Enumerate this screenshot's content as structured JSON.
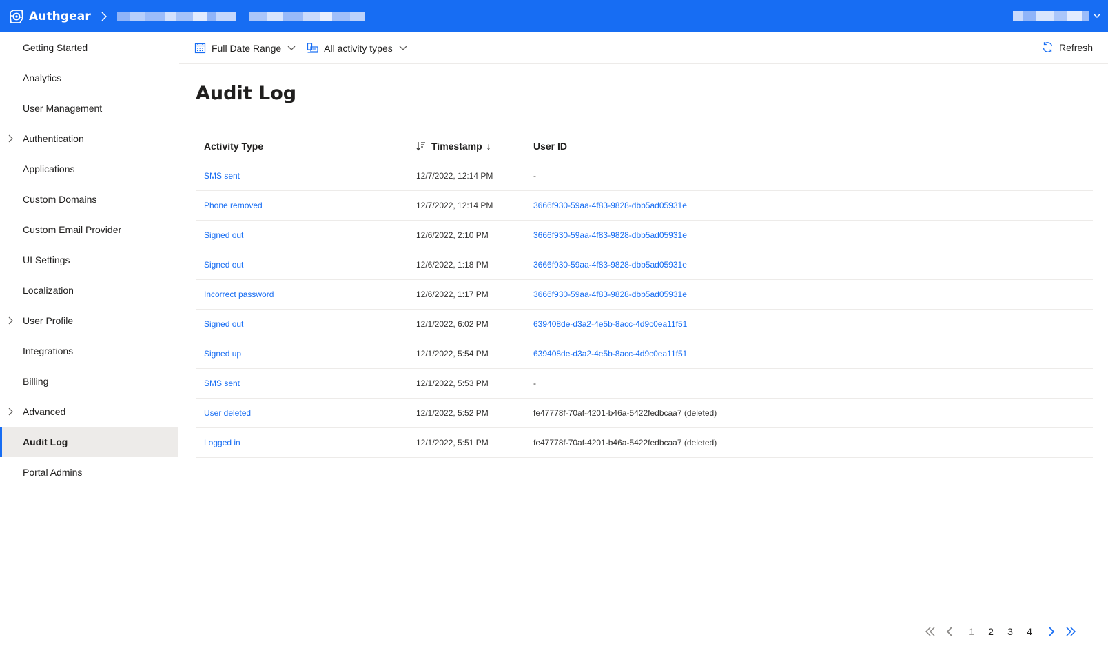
{
  "header": {
    "brand": "Authgear",
    "colors": {
      "primary": "#176df3",
      "text": "#201f1e",
      "link": "#176df3"
    }
  },
  "sidebar": {
    "items": [
      {
        "label": "Getting Started",
        "expandable": false
      },
      {
        "label": "Analytics",
        "expandable": false
      },
      {
        "label": "User Management",
        "expandable": false
      },
      {
        "label": "Authentication",
        "expandable": true
      },
      {
        "label": "Applications",
        "expandable": false
      },
      {
        "label": "Custom Domains",
        "expandable": false
      },
      {
        "label": "Custom Email Provider",
        "expandable": false
      },
      {
        "label": "UI Settings",
        "expandable": false
      },
      {
        "label": "Localization",
        "expandable": false
      },
      {
        "label": "User Profile",
        "expandable": true
      },
      {
        "label": "Integrations",
        "expandable": false
      },
      {
        "label": "Billing",
        "expandable": false
      },
      {
        "label": "Advanced",
        "expandable": true
      },
      {
        "label": "Audit Log",
        "expandable": false,
        "active": true
      },
      {
        "label": "Portal Admins",
        "expandable": false
      }
    ]
  },
  "commands": {
    "date_range": "Full Date Range",
    "activity_types": "All activity types",
    "refresh": "Refresh"
  },
  "main": {
    "title": "Audit Log",
    "columns": {
      "activity_type": "Activity Type",
      "timestamp": "Timestamp",
      "sort_arrow": "↓",
      "user_id": "User ID"
    },
    "rows": [
      {
        "type": "SMS sent",
        "timestamp": "12/7/2022, 12:14 PM",
        "user": "-",
        "user_link": false
      },
      {
        "type": "Phone removed",
        "timestamp": "12/7/2022, 12:14 PM",
        "user": "3666f930-59aa-4f83-9828-dbb5ad05931e",
        "user_link": true
      },
      {
        "type": "Signed out",
        "timestamp": "12/6/2022, 2:10 PM",
        "user": "3666f930-59aa-4f83-9828-dbb5ad05931e",
        "user_link": true
      },
      {
        "type": "Signed out",
        "timestamp": "12/6/2022, 1:18 PM",
        "user": "3666f930-59aa-4f83-9828-dbb5ad05931e",
        "user_link": true
      },
      {
        "type": "Incorrect password",
        "timestamp": "12/6/2022, 1:17 PM",
        "user": "3666f930-59aa-4f83-9828-dbb5ad05931e",
        "user_link": true
      },
      {
        "type": "Signed out",
        "timestamp": "12/1/2022, 6:02 PM",
        "user": "639408de-d3a2-4e5b-8acc-4d9c0ea11f51",
        "user_link": true
      },
      {
        "type": "Signed up",
        "timestamp": "12/1/2022, 5:54 PM",
        "user": "639408de-d3a2-4e5b-8acc-4d9c0ea11f51",
        "user_link": true
      },
      {
        "type": "SMS sent",
        "timestamp": "12/1/2022, 5:53 PM",
        "user": "-",
        "user_link": false
      },
      {
        "type": "User deleted",
        "timestamp": "12/1/2022, 5:52 PM",
        "user": "fe47778f-70af-4201-b46a-5422fedbcaa7 (deleted)",
        "user_link": false
      },
      {
        "type": "Logged in",
        "timestamp": "12/1/2022, 5:51 PM",
        "user": "fe47778f-70af-4201-b46a-5422fedbcaa7 (deleted)",
        "user_link": false
      }
    ]
  },
  "pagination": {
    "pages": [
      "1",
      "2",
      "3",
      "4"
    ],
    "current": "1"
  }
}
